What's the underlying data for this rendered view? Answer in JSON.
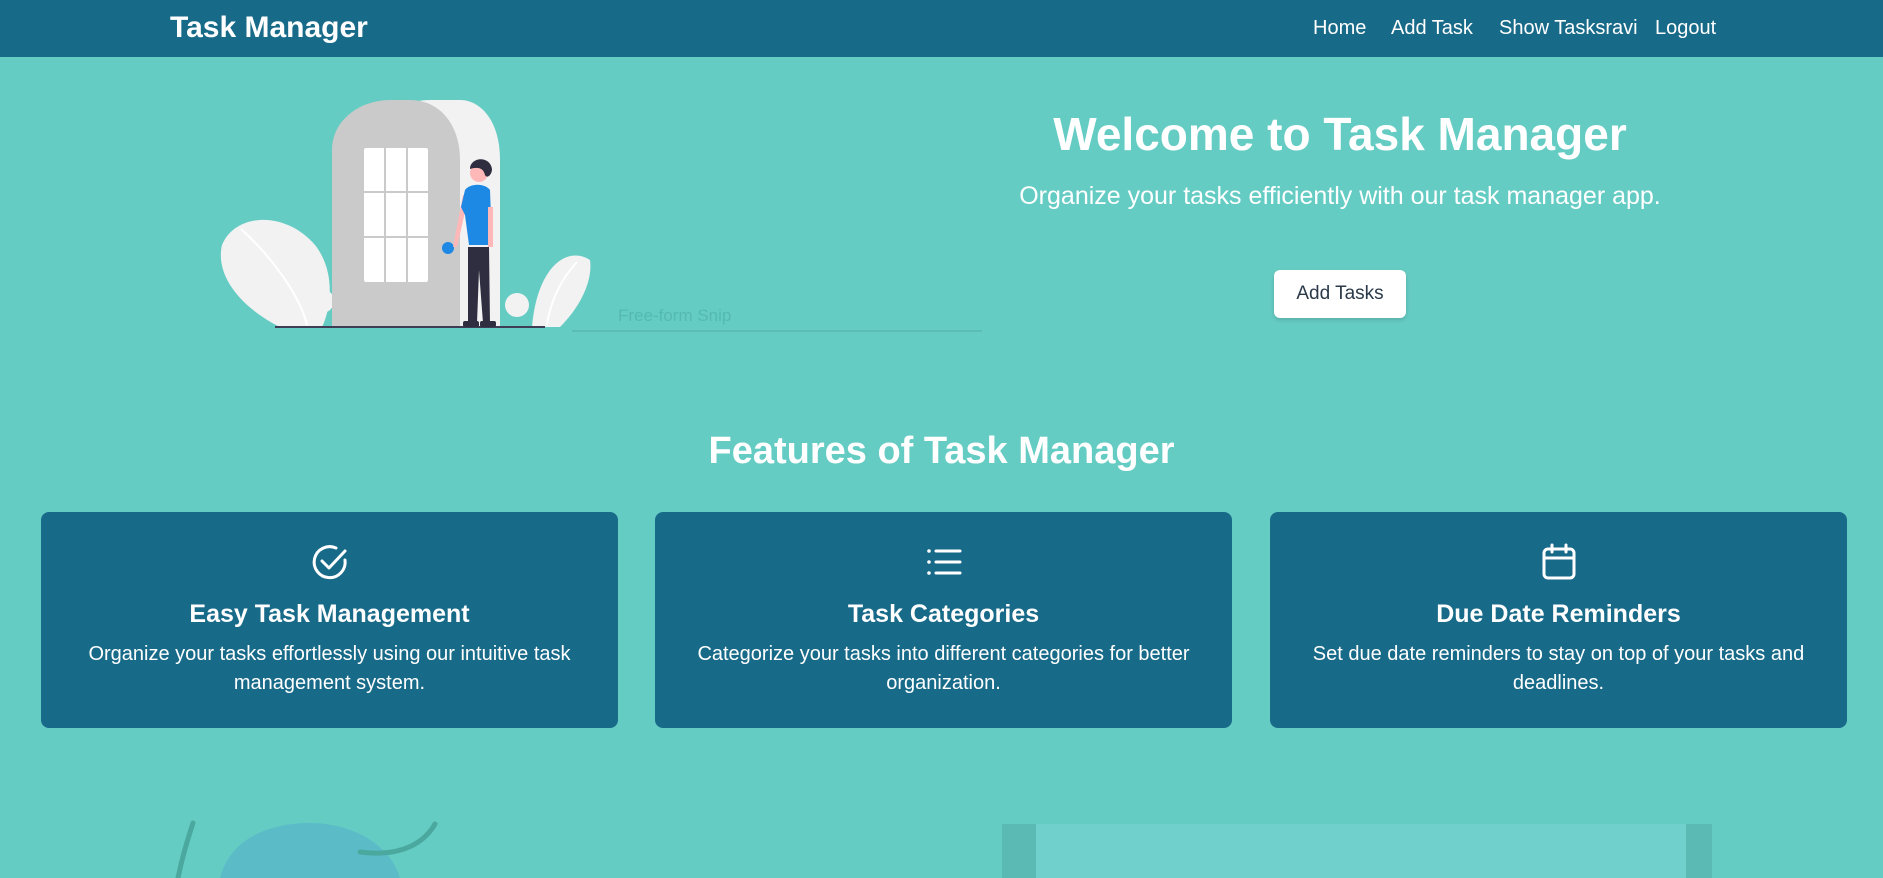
{
  "navbar": {
    "brand": "Task Manager",
    "links": [
      "Home",
      "Add Task",
      "Show Tasksravi",
      "Logout"
    ]
  },
  "hero": {
    "title": "Welcome to Task Manager",
    "subtitle": "Organize your tasks efficiently with our task manager app.",
    "button_label": "Add Tasks",
    "overlay_text": "Free-form Snip"
  },
  "features": {
    "title": "Features of Task Manager",
    "cards": [
      {
        "icon": "check-circle-icon",
        "title": "Easy Task Management",
        "text": "Organize your tasks effortlessly using our intuitive task management system."
      },
      {
        "icon": "list-icon",
        "title": "Task Categories",
        "text": "Categorize your tasks into different categories for better organization."
      },
      {
        "icon": "calendar-icon",
        "title": "Due Date Reminders",
        "text": "Set due date reminders to stay on top of your tasks and deadlines."
      }
    ]
  },
  "colors": {
    "background": "#65ccc4",
    "navbar": "#186a89",
    "card": "#186a89",
    "accent_blue": "#1e88e5"
  }
}
